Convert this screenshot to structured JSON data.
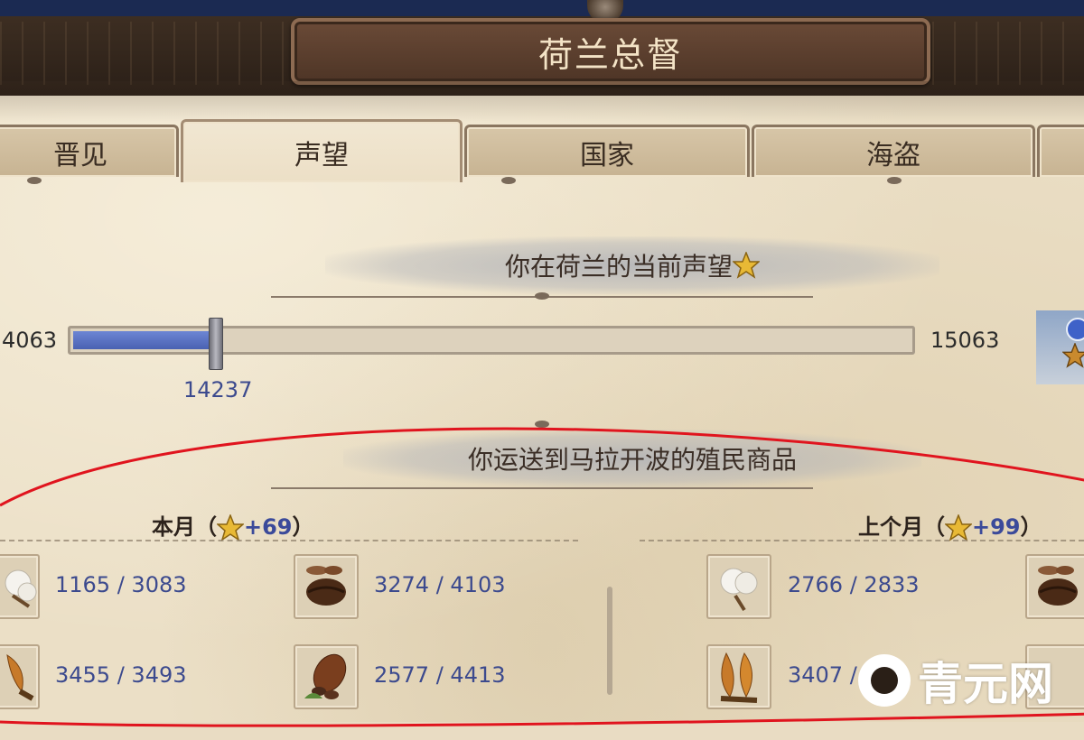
{
  "header": {
    "title": "荷兰总督"
  },
  "tabs": [
    {
      "label": "晋见",
      "active": false
    },
    {
      "label": "声望",
      "active": true
    },
    {
      "label": "国家",
      "active": false
    },
    {
      "label": "海盗",
      "active": false
    }
  ],
  "reputation": {
    "section_title": "你在荷兰的当前声望",
    "min_value": "4063",
    "max_value": "15063",
    "current_value": "14237",
    "progress_fraction": 0.17
  },
  "shipments": {
    "section_title": "你运送到马拉开波的殖民商品",
    "this_month": {
      "label": "本月（",
      "bonus": "+69",
      "close": "）",
      "goods": [
        {
          "icon": "cotton-icon",
          "text": "1165 / 3083"
        },
        {
          "icon": "coffee-icon",
          "text": "3274 / 4103"
        },
        {
          "icon": "tobacco-icon",
          "text": "3455 / 3493"
        },
        {
          "icon": "cocoa-icon",
          "text": "2577 / 4413"
        }
      ]
    },
    "last_month": {
      "label": "上个月（",
      "bonus": "+99",
      "close": "）",
      "goods": [
        {
          "icon": "cotton-icon",
          "text": "2766 / 2833"
        },
        {
          "icon": "coffee-icon",
          "text": ""
        },
        {
          "icon": "tobacco-icon",
          "text": "3407 / "
        },
        {
          "icon": "cocoa-icon",
          "text": ""
        }
      ]
    }
  },
  "watermark": {
    "text": "青元网"
  },
  "colors": {
    "bar_fill": "#4a61b2",
    "number_blue": "#3c4a8e",
    "highlight_red": "#e0141e",
    "title_text": "#f3e3c6"
  }
}
